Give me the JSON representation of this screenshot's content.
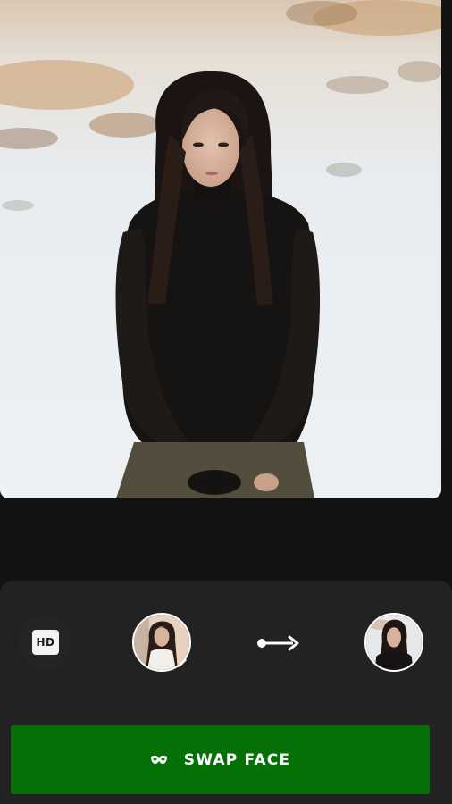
{
  "preview": {
    "image_name": "woman-in-snow-photo"
  },
  "options": {
    "hd_label": "HD"
  },
  "swap": {
    "source_icon": "source-face-avatar",
    "target_icon": "target-face-avatar",
    "arrow_icon": "arrow-right-icon"
  },
  "actions": {
    "swap_label": "SWAP FACE",
    "swap_icon": "mask-icon"
  },
  "colors": {
    "background": "#121212",
    "panel": "#232222",
    "accent_green": "#047005",
    "text_white": "#ffffff"
  }
}
